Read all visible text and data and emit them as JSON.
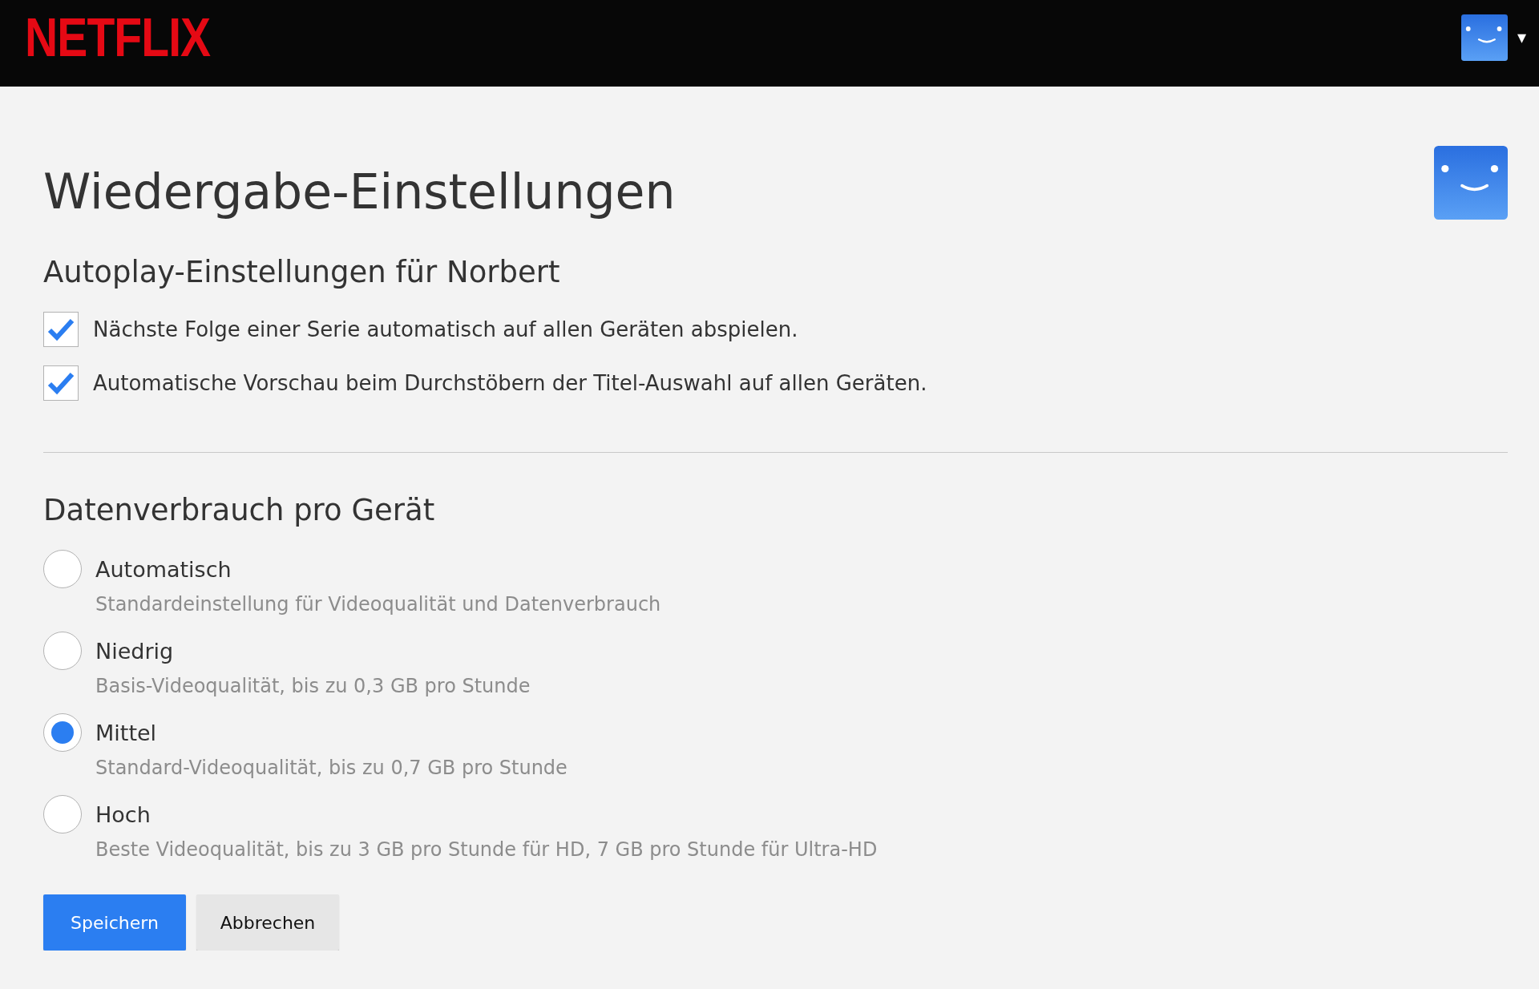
{
  "header": {
    "logo": "NETFLIX",
    "caret": "▾"
  },
  "title": "Wiedergabe-Einstellungen",
  "autoplay": {
    "heading": "Autoplay-Einstellungen für Norbert",
    "options": [
      {
        "label": "Nächste Folge einer Serie automatisch auf allen Geräten abspielen.",
        "checked": true
      },
      {
        "label": "Automatische Vorschau beim Durchstöbern der Titel-Auswahl auf allen Geräten.",
        "checked": true
      }
    ]
  },
  "data_usage": {
    "heading": "Datenverbrauch pro Gerät",
    "options": [
      {
        "label": "Automatisch",
        "description": "Standardeinstellung für Videoqualität und Datenverbrauch",
        "selected": false
      },
      {
        "label": "Niedrig",
        "description": "Basis-Videoqualität, bis zu 0,3 GB pro Stunde",
        "selected": false
      },
      {
        "label": "Mittel",
        "description": "Standard-Videoqualität, bis zu 0,7 GB pro Stunde",
        "selected": true
      },
      {
        "label": "Hoch",
        "description": "Beste Videoqualität, bis zu 3 GB pro Stunde für HD, 7 GB pro Stunde für Ultra-HD",
        "selected": false
      }
    ]
  },
  "buttons": [
    {
      "label": "Speichern",
      "kind": "primary"
    },
    {
      "label": "Abbrechen",
      "kind": "secondary"
    }
  ]
}
